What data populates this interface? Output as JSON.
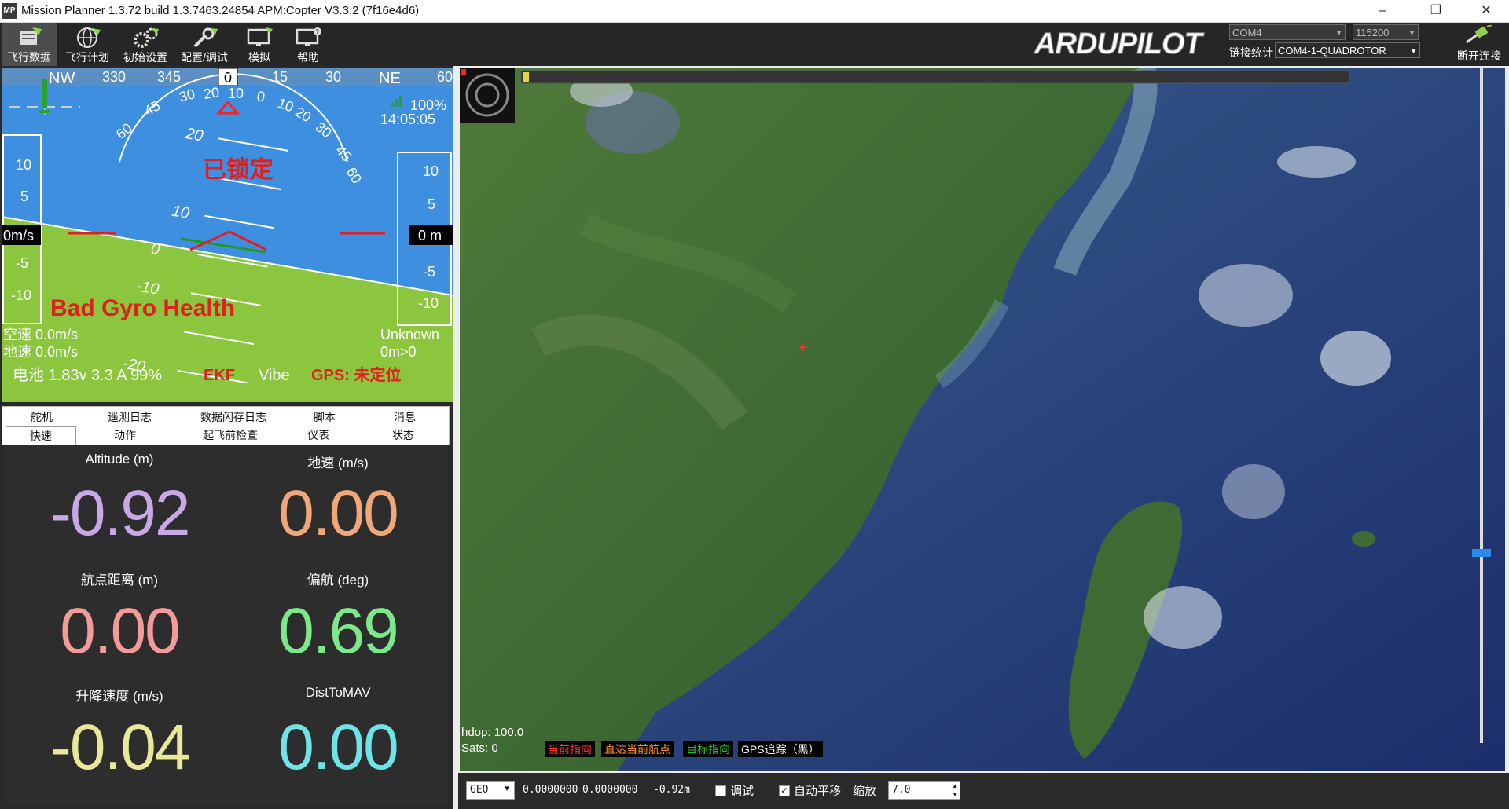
{
  "window": {
    "title": "Mission Planner 1.3.72 build 1.3.7463.24854 APM:Copter V3.3.2 (7f16e4d6)",
    "app_icon": "MP",
    "controls": [
      "–",
      "❐",
      "✕"
    ]
  },
  "toolbar": {
    "buttons": [
      {
        "label": "飞行数据",
        "icon": "flight-data-icon"
      },
      {
        "label": "飞行计划",
        "icon": "globe-icon"
      },
      {
        "label": "初始设置",
        "icon": "gears-icon"
      },
      {
        "label": "配置/调试",
        "icon": "wrench-icon"
      },
      {
        "label": "模拟",
        "icon": "monitor-icon"
      },
      {
        "label": "帮助",
        "icon": "help-icon"
      }
    ],
    "logo": "ARDUPILOT",
    "port": "COM4",
    "baud": "115200",
    "link_label": "链接统计",
    "connection": "COM4-1-QUADROTOR",
    "disconnect_label": "断开连接"
  },
  "hud": {
    "compass": {
      "labels": [
        "NW",
        "330",
        "345",
        "0",
        "15",
        "30",
        "NE",
        "60"
      ],
      "current": "0"
    },
    "roll_labels": [
      "60",
      "45",
      "30",
      "20",
      "10",
      "0",
      "10",
      "20",
      "30",
      "45",
      "60"
    ],
    "pitch_labels": [
      "20",
      "10",
      "0",
      "-10",
      "-20"
    ],
    "armed_status": "已锁定",
    "warning": "Bad Gyro Health",
    "signal": "100%",
    "time": "14:05:05",
    "speed_scale": [
      "10",
      "5",
      "-5",
      "-10"
    ],
    "alt_scale": [
      "10",
      "5",
      "-5",
      "-10"
    ],
    "speed_value": "0m/s",
    "alt_value": "0 m",
    "airspeed": "空速 0.0m/s",
    "groundspeed": "地速 0.0m/s",
    "mode": "Unknown",
    "wp": "0m>0",
    "battery": "电池 1.83v 3.3 A 99%",
    "ekf": "EKF",
    "vibe": "Vibe",
    "gps": "GPS: 未定位",
    "colors": {
      "sky": "#3f8fe0",
      "ground": "#8cc63f",
      "warning": "#e02020"
    }
  },
  "tabs": {
    "row1": [
      "舵机",
      "遥测日志",
      "数据闪存日志",
      "脚本",
      "消息"
    ],
    "row2": [
      "快速",
      "动作",
      "起飞前检查",
      "仪表",
      "状态"
    ],
    "selected": "快速"
  },
  "quick": [
    {
      "label": "Altitude (m)",
      "value": "-0.92",
      "color": "#c9a8e8"
    },
    {
      "label": "地速 (m/s)",
      "value": "0.00",
      "color": "#f0a77a"
    },
    {
      "label": "航点距离 (m)",
      "value": "0.00",
      "color": "#f39a9a"
    },
    {
      "label": "偏航 (deg)",
      "value": "0.69",
      "color": "#7de88a"
    },
    {
      "label": "升降速度 (m/s)",
      "value": "-0.04",
      "color": "#e9e89a"
    },
    {
      "label": "DistToMAV",
      "value": "0.00",
      "color": "#6fe3e6"
    }
  ],
  "map": {
    "hdop": "hdop: 100.0",
    "sats": "Sats: 0",
    "legend": [
      {
        "label": "当前指向",
        "color": "#ff3030"
      },
      {
        "label": "直达当前航点",
        "color": "#ff9020"
      },
      {
        "label": "目标指向",
        "color": "#30c030"
      },
      {
        "label": "GPS追踪（黑）",
        "color": "#ffffff"
      }
    ]
  },
  "statusbar": {
    "coord_type": "GEO",
    "lat": "0.0000000",
    "lng": "0.0000000",
    "alt": "-0.92m",
    "debug_label": "调试",
    "debug_checked": false,
    "autopan_label": "自动平移",
    "autopan_checked": true,
    "zoom_label": "缩放",
    "zoom_value": "7.0"
  }
}
